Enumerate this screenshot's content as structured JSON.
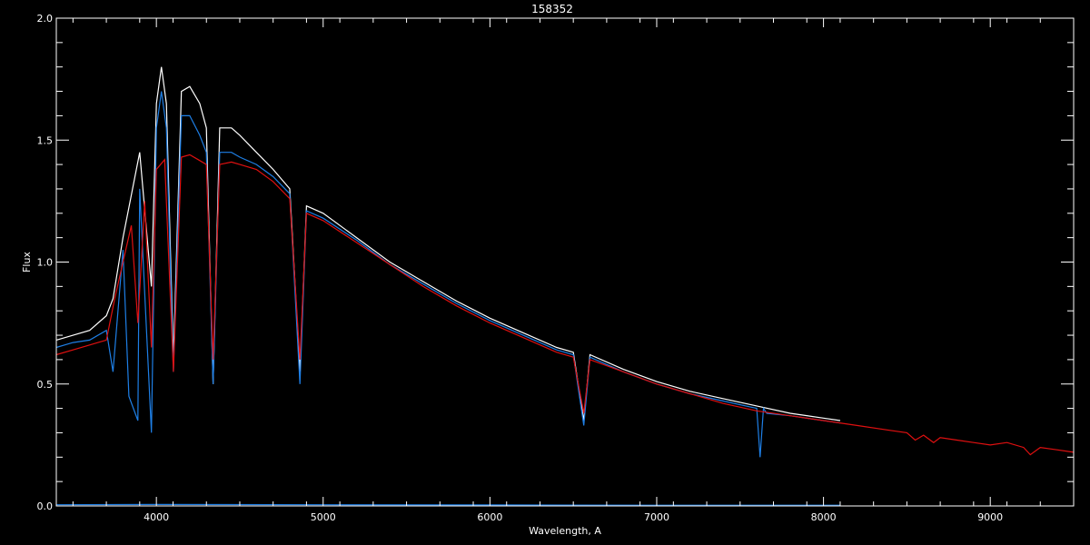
{
  "chart_data": {
    "type": "line",
    "title": "158352",
    "xlabel": "Wavelength, A",
    "ylabel": "Flux",
    "xlim": [
      3400,
      9500
    ],
    "ylim": [
      0.0,
      2.0
    ],
    "x_ticks": [
      4000,
      5000,
      6000,
      7000,
      8000,
      9000
    ],
    "y_ticks": [
      0.0,
      0.5,
      1.0,
      1.5,
      2.0
    ],
    "x_tick_labels": [
      "4000",
      "5000",
      "6000",
      "7000",
      "8000",
      "9000"
    ],
    "y_tick_labels": [
      "0.0",
      "0.5",
      "1.0",
      "1.5",
      "2.0"
    ],
    "grid": false,
    "colors": {
      "background": "#000000",
      "axes": "#ffffff"
    },
    "series": [
      {
        "color": "#ffffff",
        "x": [
          3400,
          3500,
          3600,
          3700,
          3740,
          3800,
          3900,
          3970,
          4000,
          4030,
          4060,
          4102,
          4150,
          4200,
          4260,
          4300,
          4340,
          4380,
          4450,
          4500,
          4600,
          4700,
          4800,
          4861,
          4900,
          5000,
          5200,
          5400,
          5600,
          5800,
          6000,
          6200,
          6400,
          6500,
          6563,
          6600,
          6800,
          7000,
          7200,
          7400,
          7600,
          7800,
          8000,
          8100
        ],
        "y": [
          0.68,
          0.7,
          0.72,
          0.78,
          0.85,
          1.1,
          1.45,
          0.9,
          1.65,
          1.8,
          1.65,
          0.6,
          1.7,
          1.72,
          1.65,
          1.55,
          0.5,
          1.55,
          1.55,
          1.52,
          1.45,
          1.38,
          1.3,
          0.55,
          1.23,
          1.2,
          1.1,
          1.0,
          0.92,
          0.84,
          0.77,
          0.71,
          0.65,
          0.63,
          0.35,
          0.62,
          0.56,
          0.51,
          0.47,
          0.44,
          0.41,
          0.38,
          0.36,
          0.35
        ]
      },
      {
        "color": "#1e7fe6",
        "x": [
          3400,
          3500,
          3600,
          3700,
          3740,
          3800,
          3835,
          3889,
          3900,
          3970,
          4000,
          4030,
          4060,
          4102,
          4150,
          4200,
          4260,
          4300,
          4340,
          4380,
          4450,
          4500,
          4600,
          4700,
          4800,
          4861,
          4900,
          5000,
          5200,
          5400,
          5600,
          5800,
          6000,
          6200,
          6400,
          6500,
          6563,
          6600,
          6800,
          7000,
          7200,
          7400,
          7600,
          7620,
          7640,
          7660,
          7800,
          8000,
          8100
        ],
        "y": [
          0.65,
          0.67,
          0.68,
          0.72,
          0.55,
          1.05,
          0.45,
          0.35,
          1.3,
          0.3,
          1.55,
          1.7,
          1.55,
          0.55,
          1.6,
          1.6,
          1.52,
          1.45,
          0.5,
          1.45,
          1.45,
          1.43,
          1.4,
          1.35,
          1.28,
          0.5,
          1.21,
          1.18,
          1.09,
          0.99,
          0.91,
          0.83,
          0.76,
          0.7,
          0.64,
          0.62,
          0.33,
          0.61,
          0.55,
          0.5,
          0.46,
          0.43,
          0.4,
          0.2,
          0.4,
          0.38,
          0.37,
          0.35,
          0.34
        ]
      },
      {
        "color": "#e01010",
        "x": [
          3400,
          3500,
          3600,
          3650,
          3700,
          3750,
          3800,
          3850,
          3889,
          3930,
          3970,
          4000,
          4050,
          4102,
          4150,
          4200,
          4250,
          4300,
          4340,
          4380,
          4450,
          4500,
          4600,
          4700,
          4800,
          4861,
          4900,
          5000,
          5200,
          5400,
          5600,
          5800,
          6000,
          6200,
          6400,
          6500,
          6563,
          6600,
          6800,
          7000,
          7200,
          7400,
          7600,
          7800,
          8000,
          8200,
          8400,
          8500,
          8550,
          8600,
          8660,
          8700,
          8800,
          8900,
          9000,
          9100,
          9200,
          9240,
          9300,
          9400,
          9500
        ],
        "y": [
          0.62,
          0.64,
          0.66,
          0.67,
          0.68,
          0.85,
          1.0,
          1.15,
          0.75,
          1.25,
          0.65,
          1.38,
          1.42,
          0.55,
          1.43,
          1.44,
          1.42,
          1.4,
          0.6,
          1.4,
          1.41,
          1.4,
          1.38,
          1.33,
          1.26,
          0.6,
          1.2,
          1.17,
          1.08,
          0.99,
          0.9,
          0.82,
          0.75,
          0.69,
          0.63,
          0.61,
          0.38,
          0.6,
          0.55,
          0.5,
          0.46,
          0.42,
          0.39,
          0.37,
          0.35,
          0.33,
          0.31,
          0.3,
          0.27,
          0.29,
          0.26,
          0.28,
          0.27,
          0.26,
          0.25,
          0.26,
          0.24,
          0.21,
          0.24,
          0.23,
          0.22
        ]
      },
      {
        "color": "#1e7fe6",
        "x": [
          3400,
          4000,
          5000,
          6000,
          7000,
          8000,
          8100
        ],
        "y": [
          0.005,
          0.006,
          0.005,
          0.004,
          0.003,
          0.003,
          0.003
        ]
      }
    ]
  }
}
